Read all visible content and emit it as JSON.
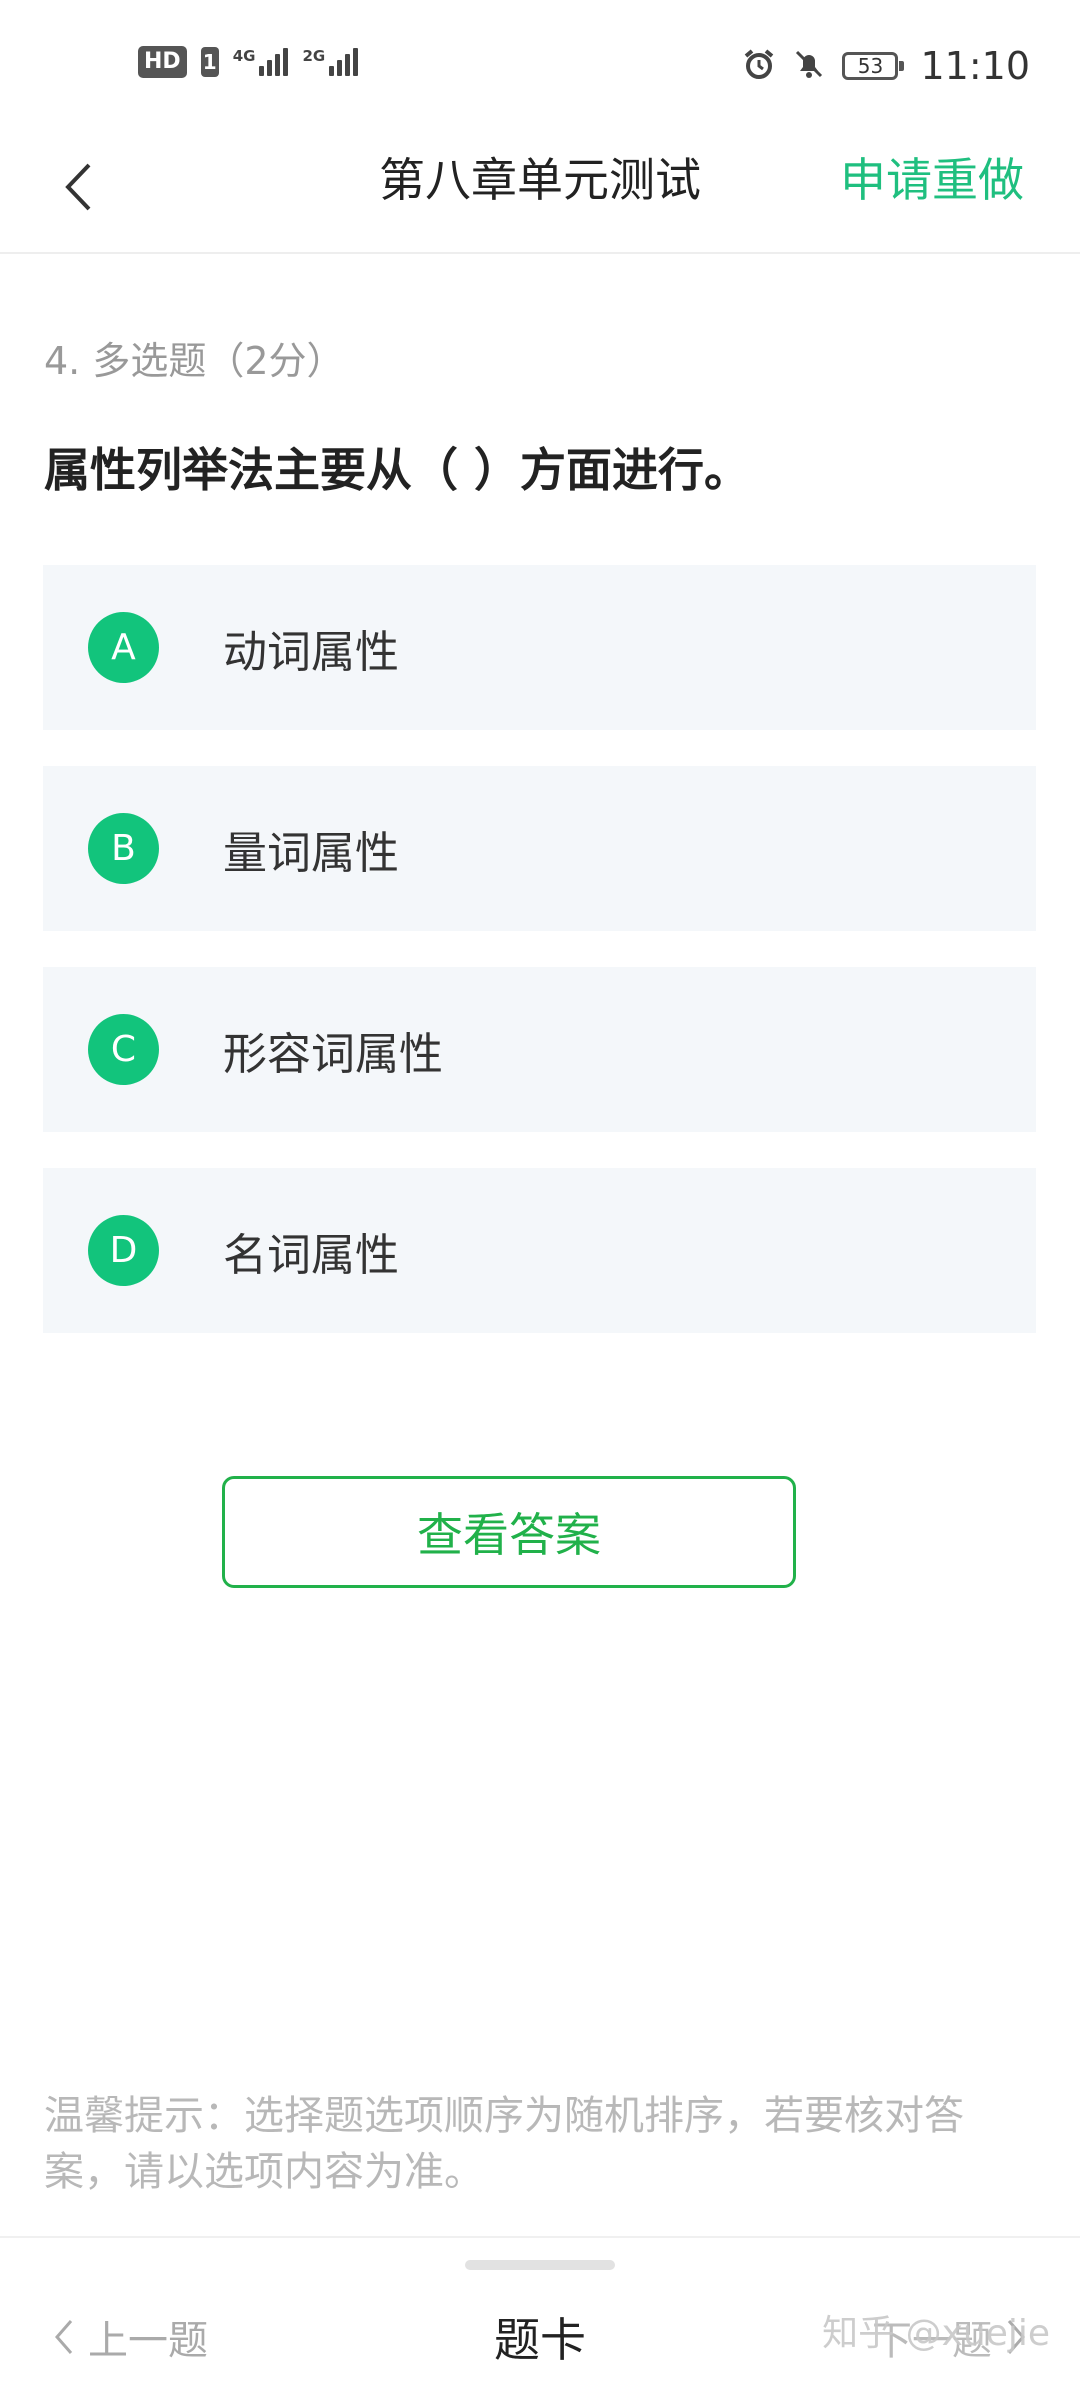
{
  "status_bar": {
    "hd": "HD",
    "sim": "1",
    "net1": "4G",
    "net2": "2G",
    "battery": "53",
    "time": "11:10"
  },
  "header": {
    "title": "第八章单元测试",
    "redo_label": "申请重做"
  },
  "question": {
    "meta": "4. 多选题（2分）",
    "stem": "属性列举法主要从（ ）方面进行。",
    "options": [
      {
        "letter": "A",
        "text": "动词属性"
      },
      {
        "letter": "B",
        "text": "量词属性"
      },
      {
        "letter": "C",
        "text": "形容词属性"
      },
      {
        "letter": "D",
        "text": "名词属性"
      }
    ]
  },
  "answer_button": "查看答案",
  "tip": "温馨提示：选择题选项顺序为随机排序，若要核对答案，请以选项内容为准。",
  "bottom": {
    "prev": "上一题",
    "card": "题卡",
    "next": "下一题"
  },
  "watermark": "知乎 @xuejie",
  "colors": {
    "accent": "#1fbf7f",
    "option_circle": "#12c47c",
    "answer_border": "#21b14a",
    "option_bg": "#f4f7fa"
  },
  "icons": [
    "back-chevron-icon",
    "alarm-icon",
    "bell-muted-icon",
    "battery-icon",
    "signal-icon"
  ]
}
